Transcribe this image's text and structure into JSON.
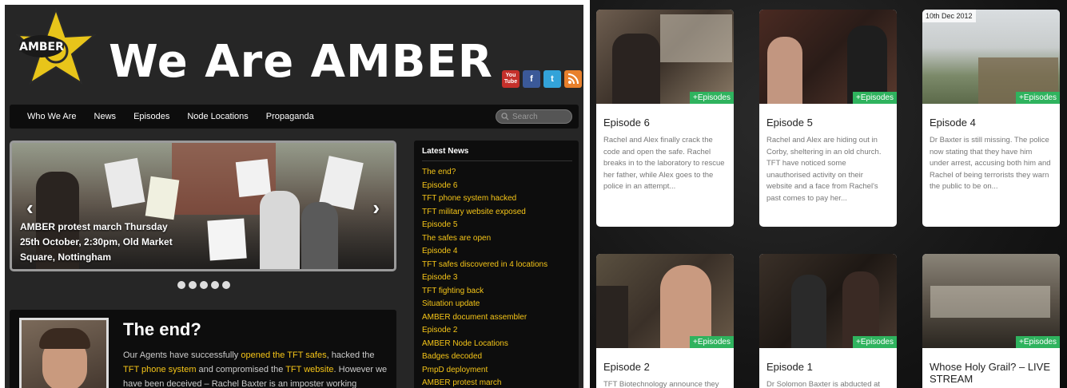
{
  "site": {
    "logo_text": "AMBER",
    "title": "We Are AMBER"
  },
  "social": [
    {
      "icon": "youtube-icon",
      "label": "You Tube",
      "color": "#c4302b"
    },
    {
      "icon": "facebook-icon",
      "label": "f",
      "color": "#3b5998"
    },
    {
      "icon": "twitter-icon",
      "label": "t",
      "color": "#33a3d9"
    },
    {
      "icon": "rss-icon",
      "label": "",
      "color": "#e8802c"
    }
  ],
  "nav": {
    "items": [
      "Who We Are",
      "News",
      "Episodes",
      "Node Locations",
      "Propaganda"
    ],
    "search_placeholder": "Search"
  },
  "slider": {
    "caption": "AMBER protest march Thursday 25th October, 2:30pm, Old Market Square, Nottingham",
    "dot_count": 5
  },
  "article": {
    "title": "The end?",
    "text_1": "Our Agents have successfully ",
    "link_1": "opened the TFT safes",
    "text_2": ", hacked the ",
    "link_2": "TFT phone system",
    "text_3": " and compromised the ",
    "link_3": "TFT website",
    "text_4": ". However we have been deceived – Rachel Baxter is an imposter working"
  },
  "news": {
    "title": "Latest News",
    "items": [
      "The end?",
      "Episode 6",
      "TFT phone system hacked",
      "TFT military website exposed",
      "Episode 5",
      "The safes are open",
      "Episode 4",
      "TFT safes discovered in 4 locations",
      "Episode 3",
      "TFT fighting back",
      "Situation update",
      "AMBER document assembler",
      "Episode 2",
      "AMBER Node Locations",
      "Badges decoded",
      "PmpD deployment",
      "AMBER protest march"
    ]
  },
  "episodes": {
    "badge_label": "+Episodes",
    "cards": [
      {
        "title": "Episode 6",
        "date": "",
        "desc": "Rachel and Alex finally crack the code and open the safe. Rachel breaks in to the laboratory to rescue her father, while Alex goes to the police in an attempt..."
      },
      {
        "title": "Episode 5",
        "date": "",
        "desc": "Rachel and Alex are hiding out in Corby, sheltering in an old church. TFT have noticed some unauthorised activity on their website and a face from Rachel's past comes to pay her..."
      },
      {
        "title": "Episode 4",
        "date": "10th Dec 2012",
        "desc": "Dr Baxter is still missing. The police now stating that they have him under arrest, accusing both him and Rachel of being terrorists they warn the public to be on..."
      },
      {
        "title": "Episode 2",
        "date": "",
        "desc": "TFT Biotechnology announce they"
      },
      {
        "title": "Episode 1",
        "date": "",
        "desc": "Dr Solomon Baxter is abducted at"
      },
      {
        "title": "Whose Holy Grail? – LIVE STREAM",
        "date": "",
        "desc": ""
      }
    ]
  }
}
